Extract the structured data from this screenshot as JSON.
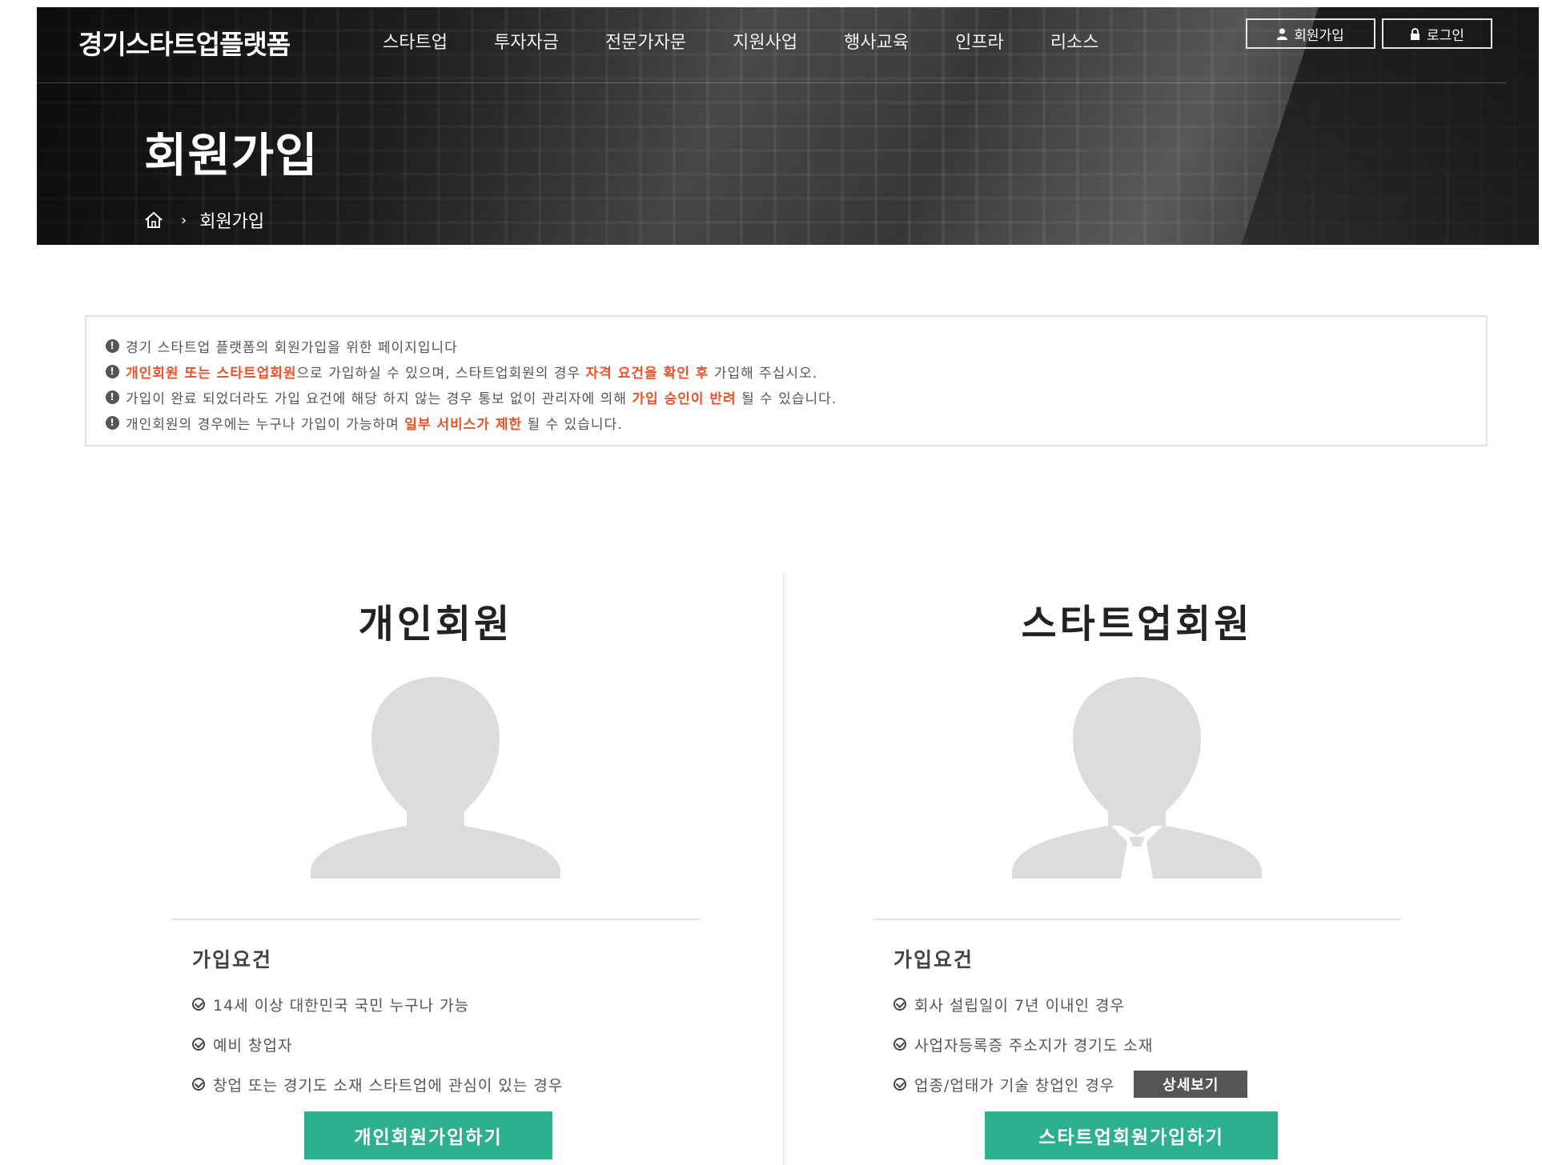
{
  "header": {
    "logo": "경기스타트업플랫폼",
    "nav": [
      "스타트업",
      "투자자금",
      "전문가자문",
      "지원사업",
      "행사교육",
      "인프라",
      "리소스"
    ],
    "join_label": "회원가입",
    "login_label": "로그인"
  },
  "hero": {
    "title": "회원가입",
    "breadcrumb": "회원가입"
  },
  "notice": {
    "line1": "경기 스타트업 플랫폼의 회원가입을 위한 페이지입니다",
    "line2": {
      "hl1": "개인회원 또는 스타트업회원",
      "t1": "으로 가입하실 수 있으며, 스타트업회원의 경우 ",
      "hl2": "자격 요건을 확인 후",
      "t2": " 가입해 주십시오."
    },
    "line3": {
      "t1": "가입이 완료 되었더라도 가입 요건에 해당 하지 않는 경우 통보 없이 관리자에 의해 ",
      "hl1": "가입 승인이 반려",
      "t2": " 될 수 있습니다."
    },
    "line4": {
      "t1": "개인회원의 경우에는 누구나 가입이 가능하며 ",
      "hl1": "일부 서비스가 제한",
      "t2": " 될 수 있습니다."
    }
  },
  "personal": {
    "title": "개인회원",
    "req_title": "가입요건",
    "requirements": [
      "14세 이상 대한민국 국민 누구나 가능",
      "예비 창업자",
      "창업 또는 경기도 소재 스타트업에 관심이 있는 경우"
    ],
    "button": "개인회원가입하기"
  },
  "startup": {
    "title": "스타트업회원",
    "req_title": "가입요건",
    "requirements": [
      "회사 설립일이 7년 이내인 경우",
      "사업자등록증 주소지가 경기도 소재",
      "업종/업태가 기술 창업인 경우"
    ],
    "detail_button": "상세보기",
    "button": "스타트업회원가입하기"
  },
  "colors": {
    "accent": "#2eb08f",
    "highlight": "#e8532a",
    "avatar": "#dcdcdc"
  }
}
